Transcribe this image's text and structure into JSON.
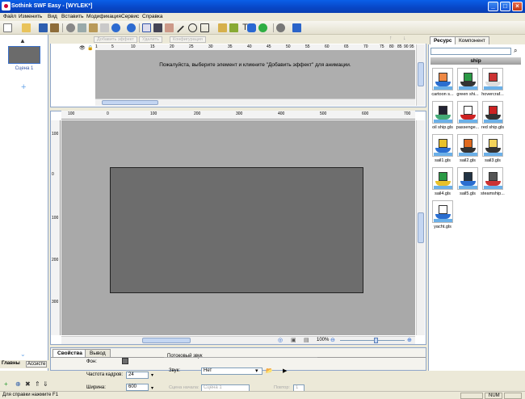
{
  "window": {
    "title": "Sothink SWF Easy - [WYLEK*]"
  },
  "menu": [
    "Файл",
    "Изменить",
    "Вид",
    "Вставить",
    "Модификация",
    "Сервис",
    "Справка"
  ],
  "scenes": {
    "items": [
      {
        "label": "Сцена 1"
      }
    ]
  },
  "left_tabs": {
    "main": "Главны",
    "assistant": "Ассисте"
  },
  "timeline": {
    "add_effect": "Добавить эффект",
    "delete": "Удалить",
    "configure": "Конфигурация",
    "message": "Пожалуйста, выберите элемент и кликните \"Добавить эффект\" для анимации.",
    "ruler_ticks": [
      "1",
      "5",
      "10",
      "15",
      "20",
      "25",
      "30",
      "35",
      "40",
      "45",
      "50",
      "55",
      "60",
      "65",
      "70",
      "75",
      "80",
      "85",
      "90",
      "95"
    ]
  },
  "stage": {
    "hruler": [
      "100",
      "0",
      "100",
      "200",
      "300",
      "400",
      "500",
      "600",
      "700"
    ],
    "vruler": [
      "100",
      "0",
      "100",
      "200",
      "300"
    ],
    "zoom": "100%",
    "zoom_level": 0.55
  },
  "resources": {
    "tabs": {
      "resource": "Ресурс",
      "component": "Компонент"
    },
    "folder": "ship",
    "items": [
      {
        "label": "cartoon s...",
        "icon": "cartoon-ship-icon"
      },
      {
        "label": "green shi...",
        "icon": "green-ship-icon"
      },
      {
        "label": "hovercraf...",
        "icon": "hovercraft-icon"
      },
      {
        "label": "oil ship.gls",
        "icon": "oil-ship-icon"
      },
      {
        "label": "passenge...",
        "icon": "passenger-ship-icon"
      },
      {
        "label": "red ship.gls",
        "icon": "red-ship-icon"
      },
      {
        "label": "sail1.gls",
        "icon": "sail1-icon"
      },
      {
        "label": "sail2.gls",
        "icon": "sail2-icon"
      },
      {
        "label": "sail3.gls",
        "icon": "sail3-icon"
      },
      {
        "label": "sail4.gls",
        "icon": "sail4-icon"
      },
      {
        "label": "sail5.gls",
        "icon": "sail5-icon"
      },
      {
        "label": "steamship...",
        "icon": "steamship-icon"
      },
      {
        "label": "yacht.gls",
        "icon": "yacht-icon"
      }
    ]
  },
  "properties": {
    "tabs": {
      "props": "Свойства",
      "output": "Вывод"
    },
    "background_label": "Фон:",
    "framerate_label": "Частота кадров:",
    "framerate_value": "24",
    "width_label": "Ширина:",
    "width_value": "600",
    "stream_sound_title": "Потоковый звук",
    "sound_label": "Звук:",
    "sound_value": "Нет",
    "sound_start_label": "Сцена начала:",
    "sound_start_value": "Сцена 1",
    "repeat_label": "Повтор:",
    "repeat_value": "1"
  },
  "status": {
    "help": "Для справки нажмите F1",
    "num": "NUM"
  },
  "colors": {
    "title_bar": "#0846c6",
    "stage": "#6d6d6d",
    "workspace": "#a9a9a9"
  }
}
